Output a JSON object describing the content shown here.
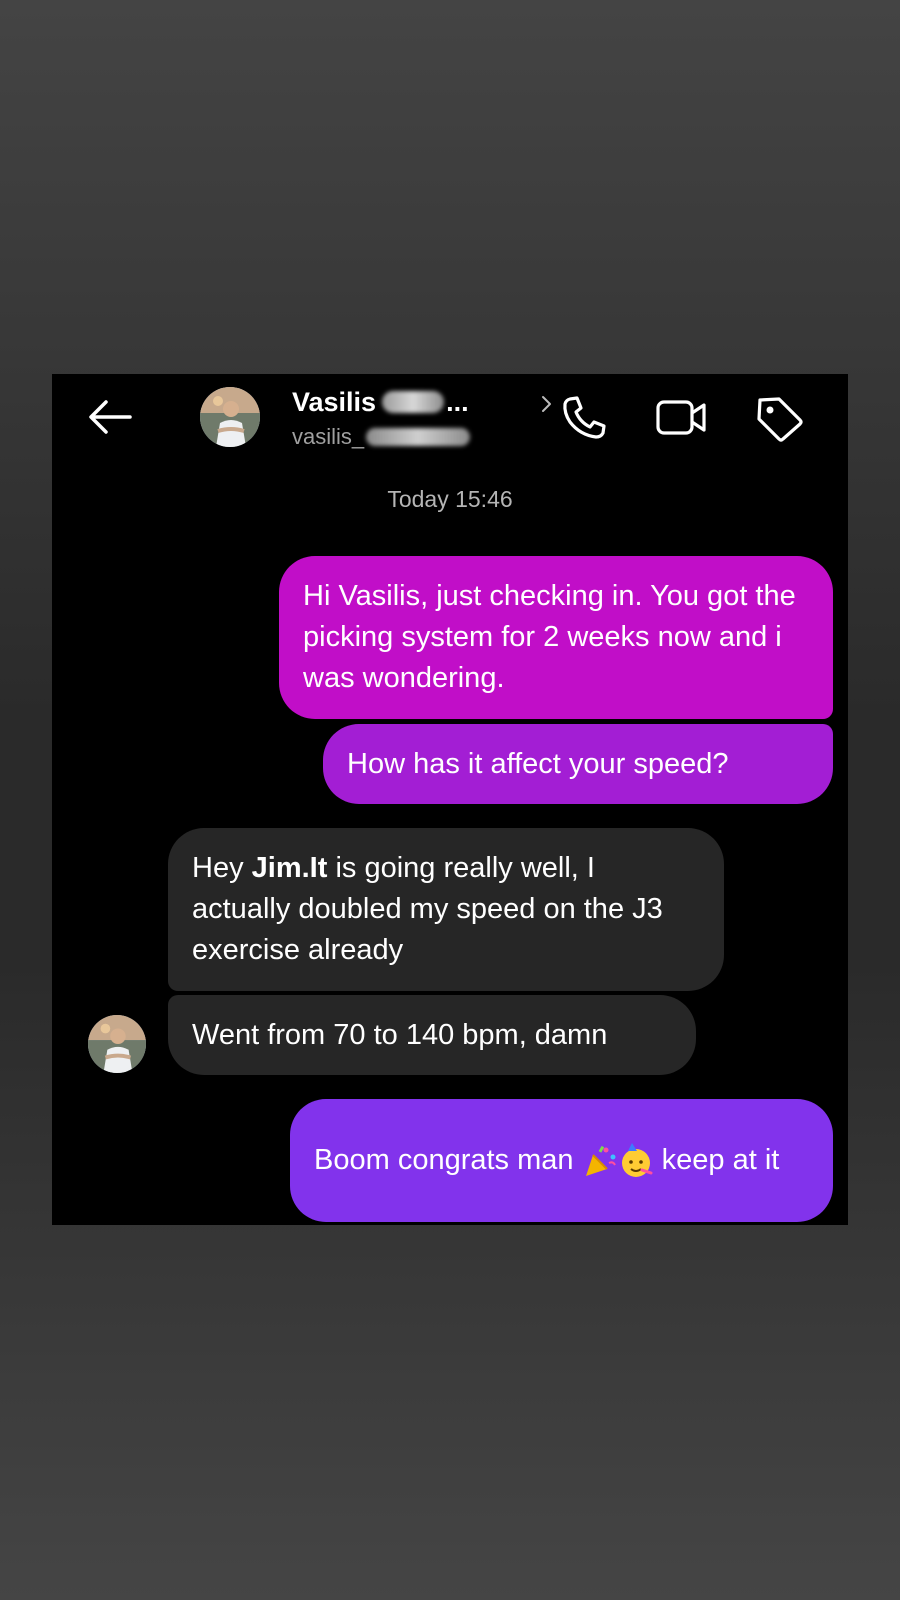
{
  "header": {
    "contact_name": "Vasilis",
    "name_ellipsis": "...",
    "username": "vasilis_"
  },
  "chat": {
    "timestamp": "Today 15:46",
    "messages": [
      {
        "sender": "me",
        "text": "Hi Vasilis, just checking in. You got the picking system for 2 weeks now and i was wondering."
      },
      {
        "sender": "me",
        "text": "How has it affect your speed?"
      },
      {
        "sender": "them",
        "prefix": "Hey ",
        "bold": "Jim.It",
        "suffix": " is going really well,  I actually doubled my speed on the J3 exercise already"
      },
      {
        "sender": "them",
        "text": "Went from 70 to 140 bpm, damn"
      },
      {
        "sender": "me",
        "prefix": "Boom congrats man ",
        "emojis": [
          "party-popper",
          "partying-face"
        ],
        "suffix": " keep at it"
      }
    ]
  },
  "colors": {
    "bubble_me_1": "#c10ec8",
    "bubble_me_2": "#a31ed4",
    "bubble_me_3": "#8233ec",
    "bubble_them": "#262626",
    "screen_bg": "#000000"
  }
}
